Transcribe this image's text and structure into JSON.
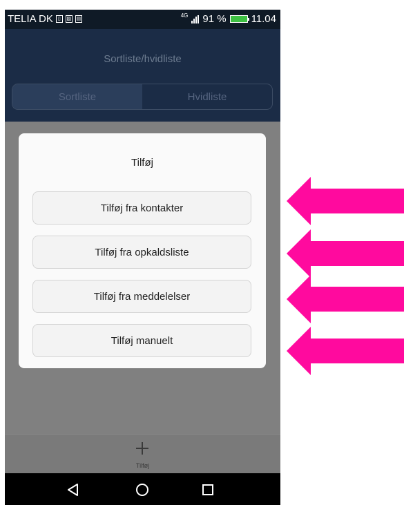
{
  "status_bar": {
    "carrier": "TELIA DK",
    "network": "4G",
    "battery_percent": "91 %",
    "time": "11.04"
  },
  "header": {
    "title": "Sortliste/hvidliste",
    "tabs": [
      {
        "label": "Sortliste",
        "selected": true
      },
      {
        "label": "Hvidliste",
        "selected": false
      }
    ]
  },
  "dialog": {
    "title": "Tilføj",
    "options": [
      {
        "label": "Tilføj fra kontakter"
      },
      {
        "label": "Tilføj fra opkaldsliste"
      },
      {
        "label": "Tilføj fra meddelelser"
      },
      {
        "label": "Tilføj manuelt"
      }
    ]
  },
  "bottom_bar": {
    "add_label": "Tilføj",
    "add_icon": "plus-icon"
  },
  "nav_bar": {
    "icons": [
      "back-icon",
      "home-icon",
      "recents-icon"
    ]
  },
  "annotation": {
    "arrow_color": "#ff0a9e",
    "arrow_count": 4
  },
  "colors": {
    "header_bg": "#1b2c46",
    "overlay": "#808080",
    "dialog_bg": "#fafafa"
  }
}
